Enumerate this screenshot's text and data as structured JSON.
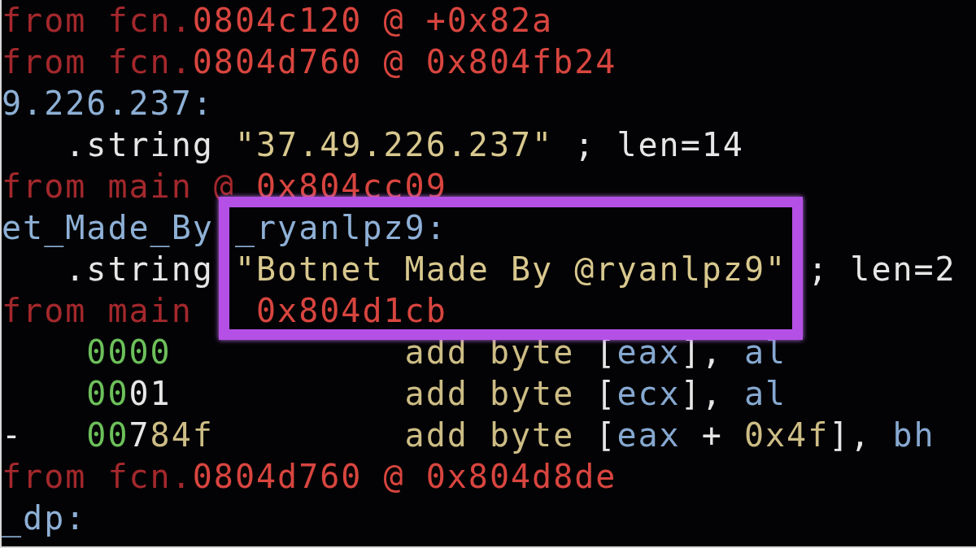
{
  "lines": [
    {
      "segments": [
        {
          "text": "from fcn.",
          "kind": "xref"
        },
        {
          "text": "0804c120 @ +0x82a",
          "kind": "address"
        }
      ]
    },
    {
      "segments": [
        {
          "text": "from fcn.",
          "kind": "xref"
        },
        {
          "text": "0804d760 @ 0x804fb24",
          "kind": "address"
        }
      ]
    },
    {
      "segments": [
        {
          "text": "9.226.237:",
          "kind": "label"
        }
      ]
    },
    {
      "segments": [
        {
          "text": "   .string ",
          "kind": "plain"
        },
        {
          "text": "\"37.49.226.237\"",
          "kind": "string"
        },
        {
          "text": " ; len=14",
          "kind": "plain"
        }
      ]
    },
    {
      "segments": [
        {
          "text": "from main @ ",
          "kind": "xref"
        },
        {
          "text": "0x804cc09",
          "kind": "address"
        }
      ]
    },
    {
      "segments": [
        {
          "text": "et_Made_By",
          "kind": "label"
        },
        {
          "text": " _ryanlpz9:",
          "kind": "label"
        }
      ]
    },
    {
      "segments": [
        {
          "text": "   .string ",
          "kind": "plain"
        },
        {
          "text": "\"Botnet Made By @ryanlpz9\"",
          "kind": "string"
        },
        {
          "text": " ; len=2",
          "kind": "plain"
        }
      ]
    },
    {
      "segments": [
        {
          "text": "from main",
          "kind": "xref"
        },
        {
          "text": "   0x804d1cb",
          "kind": "address"
        }
      ]
    },
    {
      "segments": [
        {
          "text": "    0000",
          "kind": "offset"
        },
        {
          "text": "           add byte",
          "kind": "opcode"
        },
        {
          "text": " [",
          "kind": "plain"
        },
        {
          "text": "eax",
          "kind": "register"
        },
        {
          "text": "],",
          "kind": "plain"
        },
        {
          "text": " al",
          "kind": "register"
        }
      ]
    },
    {
      "segments": [
        {
          "text": "    00",
          "kind": "offset"
        },
        {
          "text": "01",
          "kind": "plain"
        },
        {
          "text": "           add byte",
          "kind": "opcode"
        },
        {
          "text": " [",
          "kind": "plain"
        },
        {
          "text": "ecx",
          "kind": "register"
        },
        {
          "text": "],",
          "kind": "plain"
        },
        {
          "text": " al",
          "kind": "register"
        }
      ]
    },
    {
      "segments": [
        {
          "text": "-",
          "kind": "plain"
        },
        {
          "text": "   00",
          "kind": "offset"
        },
        {
          "text": "7",
          "kind": "plain"
        },
        {
          "text": "84f",
          "kind": "opcode"
        },
        {
          "text": "         add byte",
          "kind": "opcode"
        },
        {
          "text": " [",
          "kind": "plain"
        },
        {
          "text": "eax",
          "kind": "register"
        },
        {
          "text": " + ",
          "kind": "plain"
        },
        {
          "text": "0x4f",
          "kind": "opcode"
        },
        {
          "text": "],",
          "kind": "plain"
        },
        {
          "text": " bh",
          "kind": "register"
        }
      ]
    },
    {
      "segments": [
        {
          "text": "from fcn.",
          "kind": "xref"
        },
        {
          "text": "0804d760 @ 0x804d8de",
          "kind": "address"
        }
      ]
    },
    {
      "segments": [
        {
          "text": "_dp:",
          "kind": "label"
        }
      ]
    }
  ],
  "highlight": {
    "shown": true
  }
}
